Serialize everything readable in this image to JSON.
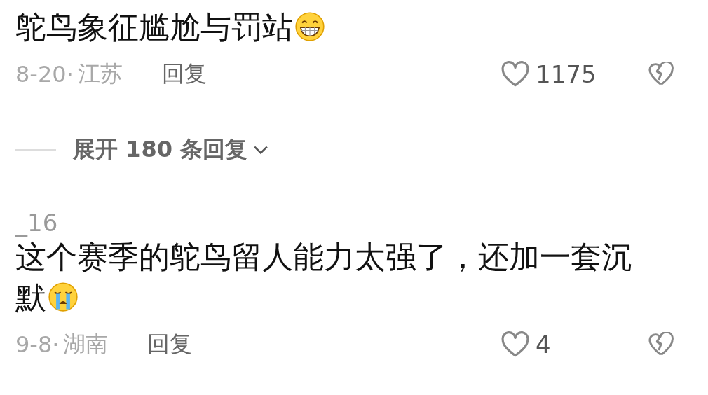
{
  "comments": [
    {
      "text": "鸵鸟象征尴尬与罚站",
      "emoji": {
        "kind": "grin"
      },
      "date": "8-20·",
      "location": "江苏",
      "reply": "回复",
      "liked": false,
      "likes": "1175",
      "disliked": false,
      "expand": {
        "label": "展开 180 条回复"
      }
    },
    {
      "username": "_16",
      "text": "这个赛季的鸵鸟留人能力太强了，还加一套沉默",
      "emoji": {
        "kind": "cry"
      },
      "date": "9-8·",
      "location": "湖南",
      "reply": "回复",
      "liked": false,
      "likes": "4",
      "disliked": false
    }
  ]
}
